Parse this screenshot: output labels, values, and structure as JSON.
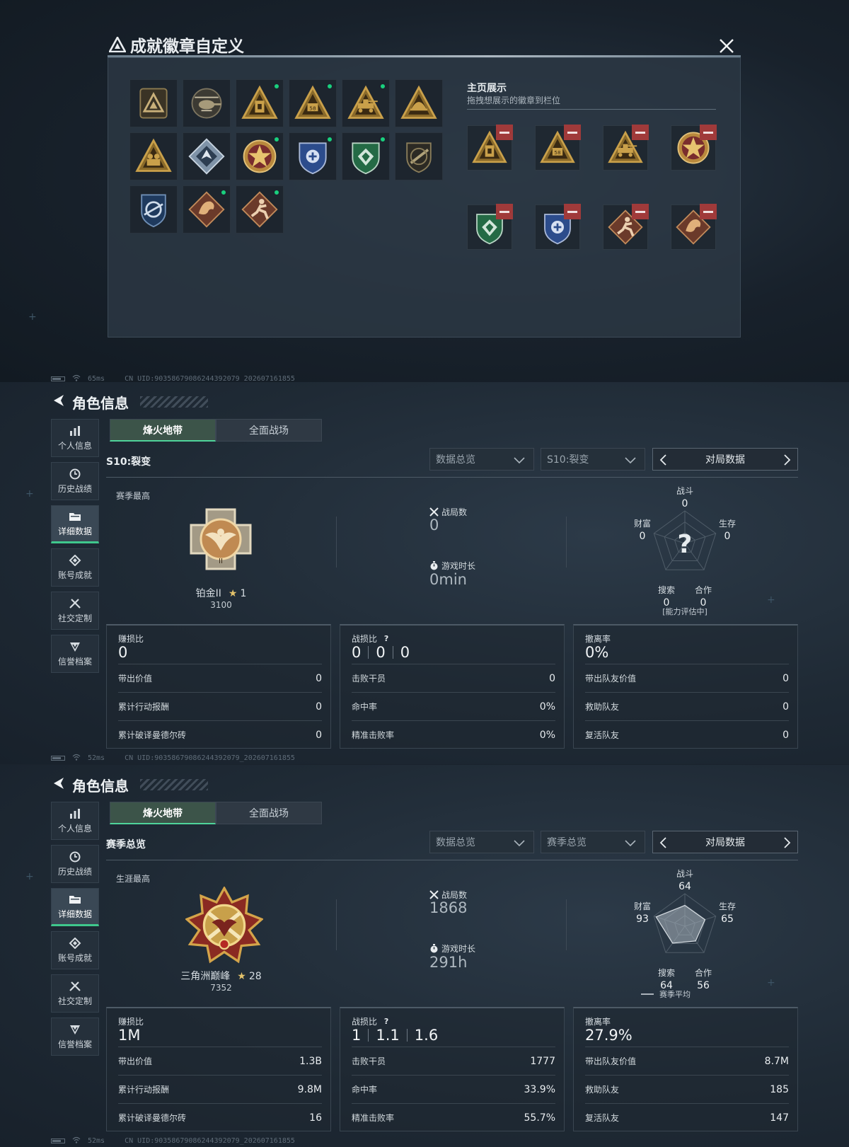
{
  "modal": {
    "title": "成就徽章自定义",
    "display_title": "主页展示",
    "display_subtitle": "拖拽想展示的徽章到栏位",
    "badges": [
      {
        "icon": "triangle-emblem-badge-icon",
        "new": false
      },
      {
        "icon": "helicopter-badge-icon",
        "new": false
      },
      {
        "icon": "gold-triangle-door-badge-icon",
        "new": true
      },
      {
        "icon": "gold-triangle-58-badge-icon",
        "new": true
      },
      {
        "icon": "gold-triangle-tank-badge-icon",
        "new": true
      },
      {
        "icon": "gold-triangle-helmet-badge-icon",
        "new": false
      },
      {
        "icon": "gold-triangle-soldiers-badge-icon",
        "new": false
      },
      {
        "icon": "silver-diamond-wolf-badge-icon",
        "new": false
      },
      {
        "icon": "red-star-shield-badge-icon",
        "new": true
      },
      {
        "icon": "blue-shield-badge-icon",
        "new": true
      },
      {
        "icon": "green-shield-badge-icon",
        "new": true
      },
      {
        "icon": "dark-rifle-shield-badge-icon",
        "new": false
      },
      {
        "icon": "blue-emblem-badge-icon",
        "new": false
      },
      {
        "icon": "bronze-dragon-badge-icon",
        "new": true
      },
      {
        "icon": "bronze-runner-badge-icon",
        "new": true
      }
    ],
    "displayed": [
      {
        "icon": "gold-triangle-door-badge-icon"
      },
      {
        "icon": "gold-triangle-58-badge-icon"
      },
      {
        "icon": "gold-triangle-tank-badge-icon"
      },
      {
        "icon": "red-star-shield-badge-icon"
      },
      {
        "icon": "green-shield-badge-icon"
      },
      {
        "icon": "blue-shield-badge-icon"
      },
      {
        "icon": "bronze-runner-badge-icon"
      },
      {
        "icon": "bronze-dragon-badge-icon"
      }
    ]
  },
  "status1": {
    "ping": "65ms",
    "uid": "CN UID:9035867908624439​2079_202607161855"
  },
  "status2": {
    "ping": "52ms",
    "uid": "CN UID:9035867908624439​2079_202607161855"
  },
  "status3": {
    "ping": "52ms",
    "uid": "CN UID:9035867908624439​2079_202607161855"
  },
  "nav": [
    "个人信息",
    "历史战绩",
    "详细数据",
    "账号成就",
    "社交定制",
    "信誉档案"
  ],
  "header_title": "角色信息",
  "tabs": [
    "烽火地带",
    "全面战场"
  ],
  "profile1": {
    "season": "S10:裂变",
    "select1": "数据总览",
    "select2": "S10:裂变",
    "match_data": "对局数据",
    "peak_label": "赛季最高",
    "rank_name": "铂金II",
    "rank_stars": "1",
    "rank_score": "3100",
    "matches_label": "战局数",
    "matches": "0",
    "playtime_label": "游戏时长",
    "playtime": "0min",
    "radar": {
      "labels": [
        "战斗",
        "生存",
        "合作",
        "搜索",
        "财富"
      ],
      "values": [
        "0",
        "0",
        "0",
        "0",
        "0"
      ],
      "center": "?",
      "footer": "[能力评估中]",
      "levels": [
        0,
        0,
        0,
        0,
        0
      ]
    },
    "card1": {
      "title": "赚损比",
      "value": "0",
      "rows": [
        [
          "带出价值",
          "0"
        ],
        [
          "累计行动报酬",
          "0"
        ],
        [
          "累计破译曼德尔砖",
          "0"
        ]
      ]
    },
    "card2": {
      "title": "战损比",
      "values": [
        "0",
        "0",
        "0"
      ],
      "rows": [
        [
          "击败干员",
          "0"
        ],
        [
          "命中率",
          "0%"
        ],
        [
          "精准击败率",
          "0%"
        ]
      ]
    },
    "card3": {
      "title": "撤离率",
      "value": "0%",
      "rows": [
        [
          "带出队友价值",
          "0"
        ],
        [
          "救助队友",
          "0"
        ],
        [
          "复活队友",
          "0"
        ]
      ]
    }
  },
  "profile2": {
    "season": "赛季总览",
    "select1": "数据总览",
    "select2": "赛季总览",
    "match_data": "对局数据",
    "peak_label": "生涯最高",
    "rank_name": "三角洲巅峰",
    "rank_stars": "28",
    "rank_score": "7352",
    "matches_label": "战局数",
    "matches": "1868",
    "playtime_label": "游戏时长",
    "playtime": "291h",
    "radar": {
      "labels": [
        "战斗",
        "生存",
        "合作",
        "搜索",
        "财富"
      ],
      "values": [
        "64",
        "65",
        "56",
        "64",
        "93"
      ],
      "center": "",
      "footer": "赛季平均",
      "levels": [
        64,
        65,
        56,
        64,
        93
      ]
    },
    "card1": {
      "title": "赚损比",
      "value": "1M",
      "rows": [
        [
          "带出价值",
          "1.3B"
        ],
        [
          "累计行动报酬",
          "9.8M"
        ],
        [
          "累计破译曼德尔砖",
          "16"
        ]
      ]
    },
    "card2": {
      "title": "战损比",
      "values": [
        "1",
        "1.1",
        "1.6"
      ],
      "rows": [
        [
          "击败干员",
          "1777"
        ],
        [
          "命中率",
          "33.9%"
        ],
        [
          "精准击败率",
          "55.7%"
        ]
      ]
    },
    "card3": {
      "title": "撤离率",
      "value": "27.9%",
      "rows": [
        [
          "带出队友价值",
          "8.7M"
        ],
        [
          "救助队友",
          "185"
        ],
        [
          "复活队友",
          "147"
        ]
      ]
    }
  }
}
